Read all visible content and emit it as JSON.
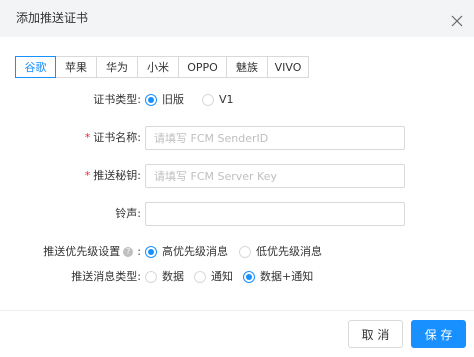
{
  "dialog": {
    "title": "添加推送证书",
    "close_icon": "close-icon"
  },
  "tabs": [
    {
      "label": "谷歌",
      "active": true
    },
    {
      "label": "苹果",
      "active": false
    },
    {
      "label": "华为",
      "active": false
    },
    {
      "label": "小米",
      "active": false
    },
    {
      "label": "OPPO",
      "active": false
    },
    {
      "label": "魅族",
      "active": false
    },
    {
      "label": "VIVO",
      "active": false
    }
  ],
  "form": {
    "cert_type": {
      "label": "证书类型:",
      "options": [
        {
          "label": "旧版",
          "selected": true
        },
        {
          "label": "V1",
          "selected": false
        }
      ]
    },
    "cert_name": {
      "required": "*",
      "label": "证书名称:",
      "value": "",
      "placeholder": "请填写 FCM SenderID"
    },
    "push_key": {
      "required": "*",
      "label": "推送秘钥:",
      "value": "",
      "placeholder": "请填写 FCM Server Key"
    },
    "ringtone": {
      "label": "铃声:",
      "value": "",
      "placeholder": ""
    },
    "priority": {
      "label": "推送优先级设置",
      "help_icon": "?",
      "colon": ":",
      "options": [
        {
          "label": "高优先级消息",
          "selected": true
        },
        {
          "label": "低优先级消息",
          "selected": false
        }
      ]
    },
    "message_type": {
      "label": "推送消息类型:",
      "options": [
        {
          "label": "数据",
          "selected": false
        },
        {
          "label": "通知",
          "selected": false
        },
        {
          "label": "数据+通知",
          "selected": true
        }
      ]
    }
  },
  "footer": {
    "cancel_label": "取 消",
    "save_label": "保 存"
  },
  "colors": {
    "accent": "#1890ff",
    "required": "#f5222d",
    "header_bg": "#f3f4f6",
    "border": "#d9d9d9"
  }
}
